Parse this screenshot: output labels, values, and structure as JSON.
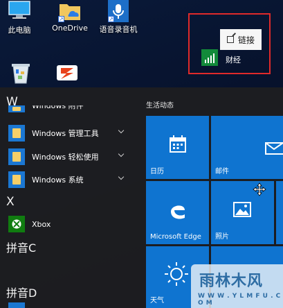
{
  "desktop": {
    "icons": [
      {
        "label": "此电脑",
        "icon": "computer-icon"
      },
      {
        "label": "OneDrive",
        "icon": "onedrive-icon"
      },
      {
        "label": "语音录音机",
        "icon": "voice-recorder-icon"
      },
      {
        "label": "",
        "icon": "recycle-bin-icon"
      },
      {
        "label": "",
        "icon": "app-logo-icon"
      }
    ]
  },
  "annotation": {
    "popup_label": "链接",
    "finance_label": "财经",
    "highlight_color": "#e02a2a"
  },
  "app_list": {
    "letter_w": "W",
    "partial_item": "Windows 附件",
    "items_w": [
      {
        "label": "Windows 管理工具",
        "expandable": true
      },
      {
        "label": "Windows 轻松使用",
        "expandable": true
      },
      {
        "label": "Windows 系统",
        "expandable": true
      }
    ],
    "letter_x": "X",
    "xbox_label": "Xbox",
    "pinyin_c": "拼音C",
    "pinyin_d": "拼音D"
  },
  "tiles": {
    "group_title": "生活动态",
    "calendar_label": "日历",
    "mail_label": "邮件",
    "edge_label": "Microsoft Edge",
    "photos_label": "照片",
    "weather_label": "天气",
    "tile_color": "#0f74d0"
  },
  "watermark": {
    "main": "雨林木风",
    "sub": "W W W . Y L M F U . C O M"
  }
}
